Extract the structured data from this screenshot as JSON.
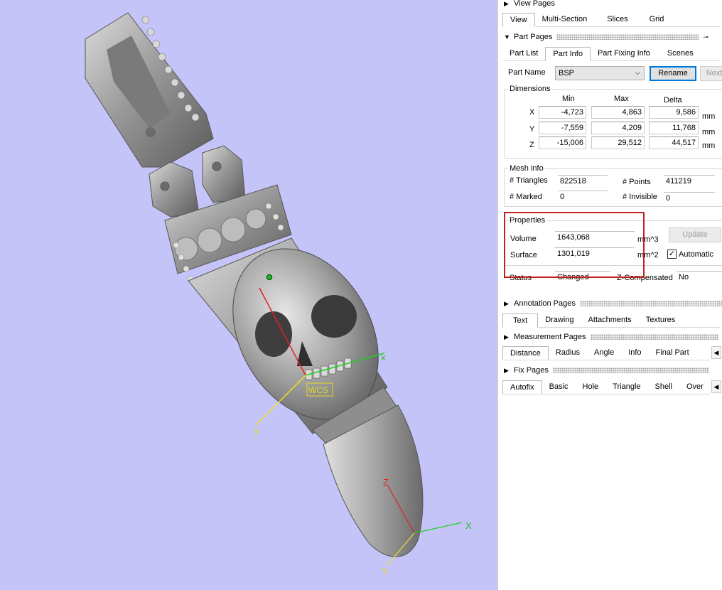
{
  "viewport": {
    "wcs_label": "WCS",
    "axes": {
      "x": "x",
      "y": "y",
      "X": "X",
      "Y": "Y",
      "Z": "Z"
    },
    "background": "#c4c4f8"
  },
  "view_pages": {
    "title": "View Pages",
    "tabs": [
      "View",
      "Multi-Section",
      "Slices",
      "Grid"
    ]
  },
  "part_pages": {
    "title": "Part Pages",
    "tabs": [
      "Part List",
      "Part Info",
      "Part Fixing Info",
      "Scenes"
    ],
    "part_name_label": "Part Name",
    "part_name_value": "BSP",
    "rename_label": "Rename",
    "next_label": "Next"
  },
  "dimensions": {
    "title": "Dimensions",
    "col_min": "Min",
    "col_max": "Max",
    "col_delta": "Delta",
    "rows": [
      {
        "axis": "X",
        "min": "-4,723",
        "max": "4,863",
        "delta": "9,586",
        "unit": "mm"
      },
      {
        "axis": "Y",
        "min": "-7,559",
        "max": "4,209",
        "delta": "11,768",
        "unit": "mm"
      },
      {
        "axis": "Z",
        "min": "-15,006",
        "max": "29,512",
        "delta": "44,517",
        "unit": "mm"
      }
    ]
  },
  "mesh_info": {
    "title": "Mesh info",
    "triangles_label": "# Triangles",
    "triangles_value": "822518",
    "points_label": "# Points",
    "points_value": "411219",
    "marked_label": "# Marked",
    "marked_value": "0",
    "invisible_label": "# Invisible",
    "invisible_value": "0"
  },
  "properties": {
    "title": "Properties",
    "volume_label": "Volume",
    "volume_value": "1643,068",
    "volume_unit": "mm^3",
    "surface_label": "Surface",
    "surface_value": "1301,019",
    "surface_unit": "mm^2",
    "update_label": "Update",
    "automatic_label": "Automatic",
    "automatic_checked": "✓",
    "status_label": "Status",
    "status_value": "Changed",
    "zcomp_label": "Z-Compensated",
    "zcomp_value": "No"
  },
  "annotation_pages": {
    "title": "Annotation Pages",
    "tabs": [
      "Text",
      "Drawing",
      "Attachments",
      "Textures"
    ]
  },
  "measurement_pages": {
    "title": "Measurement Pages",
    "tabs": [
      "Distance",
      "Radius",
      "Angle",
      "Info",
      "Final Part"
    ]
  },
  "fix_pages": {
    "title": "Fix Pages",
    "tabs": [
      "Autofix",
      "Basic",
      "Hole",
      "Triangle",
      "Shell",
      "Over"
    ]
  },
  "colors": {
    "highlight_box": "#c41e1e",
    "focus": "#0078d7"
  }
}
